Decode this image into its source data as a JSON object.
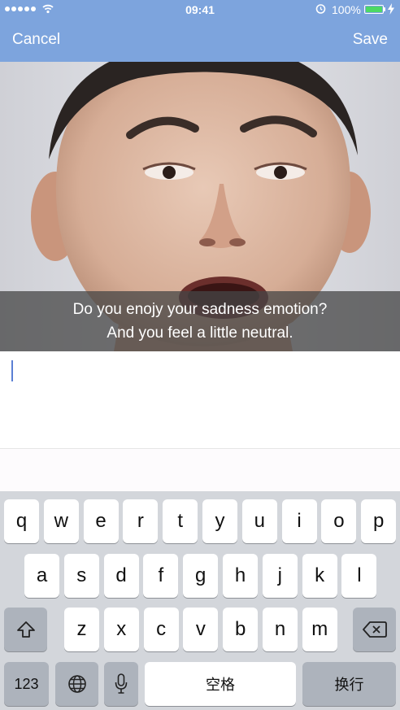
{
  "status_bar": {
    "time": "09:41",
    "battery_percent": "100%",
    "battery_level": 1.0,
    "icons": [
      "signal-dots-icon",
      "wifi-icon",
      "alarm-icon",
      "battery-icon",
      "charging-bolt-icon"
    ]
  },
  "nav": {
    "cancel_label": "Cancel",
    "save_label": "Save",
    "color": "#7da4dd"
  },
  "photo": {
    "caption_line1": "Do you enojy your sadness emotion?",
    "caption_line2": "And you feel a little neutral."
  },
  "editor": {
    "value": "",
    "cursor_color": "#5b7fd4"
  },
  "keyboard": {
    "row1": [
      "q",
      "w",
      "e",
      "r",
      "t",
      "y",
      "u",
      "i",
      "o",
      "p"
    ],
    "row2": [
      "a",
      "s",
      "d",
      "f",
      "g",
      "h",
      "j",
      "k",
      "l"
    ],
    "row3": [
      "z",
      "x",
      "c",
      "v",
      "b",
      "n",
      "m"
    ],
    "numbers_label": "123",
    "space_label": "空格",
    "return_label": "换行",
    "icons": [
      "shift-icon",
      "backspace-icon",
      "globe-icon",
      "microphone-icon"
    ]
  }
}
